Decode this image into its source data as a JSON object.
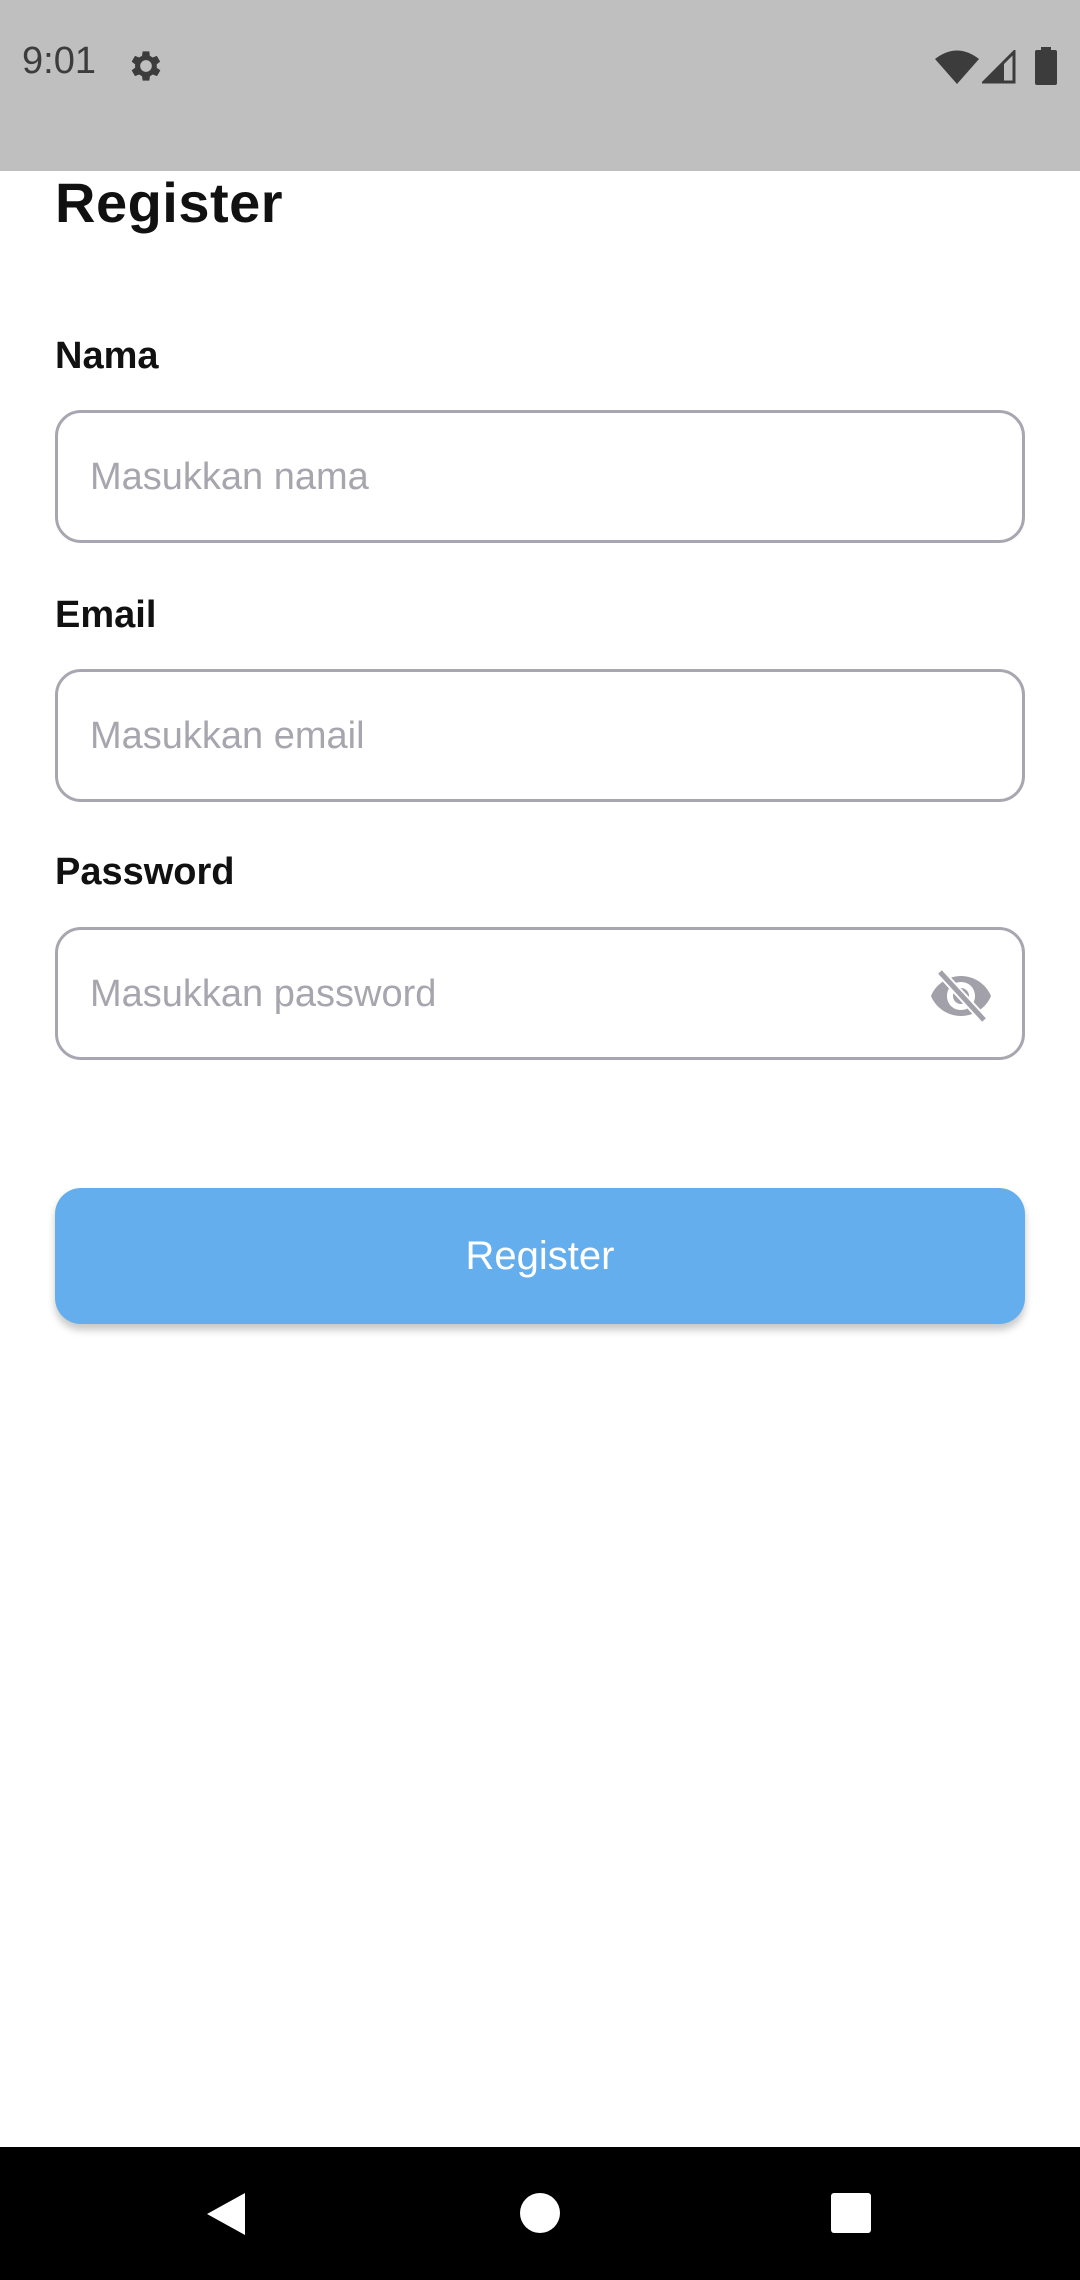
{
  "status_bar": {
    "time": "9:01",
    "icons": [
      "gear-icon",
      "wifi-icon",
      "cell-signal-icon",
      "battery-icon"
    ]
  },
  "page": {
    "title": "Register"
  },
  "form": {
    "name": {
      "label": "Nama",
      "placeholder": "Masukkan nama",
      "value": ""
    },
    "email": {
      "label": "Email",
      "placeholder": "Masukkan email",
      "value": ""
    },
    "password": {
      "label": "Password",
      "placeholder": "Masukkan password",
      "value": "",
      "toggle_icon": "eye-off-icon"
    },
    "submit_label": "Register"
  },
  "nav_bar": {
    "icons": [
      "back-icon",
      "home-icon",
      "recents-icon"
    ]
  },
  "colors": {
    "status_bar_bg": "#bfbfbf",
    "button_bg": "#64aeee",
    "field_border": "#a8a6b0",
    "placeholder": "#a7a5ae",
    "nav_bar_bg": "#000000"
  }
}
